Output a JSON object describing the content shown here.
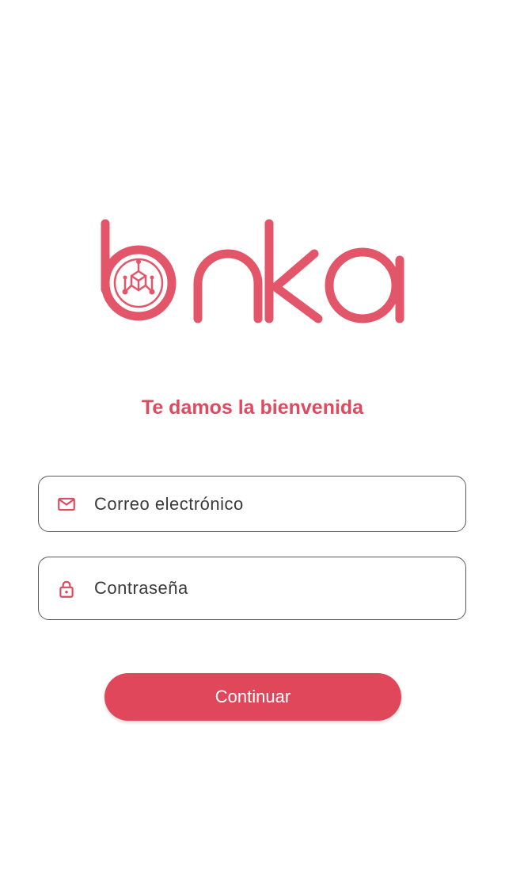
{
  "brand": {
    "logo_text": "bnka",
    "color": "#e0475b"
  },
  "welcome": {
    "title": "Te damos la bienvenida"
  },
  "form": {
    "email": {
      "placeholder": "Correo electrónico",
      "icon": "mail-icon"
    },
    "password": {
      "placeholder": "Contraseña",
      "icon": "lock-icon"
    }
  },
  "actions": {
    "continue_label": "Continuar"
  }
}
